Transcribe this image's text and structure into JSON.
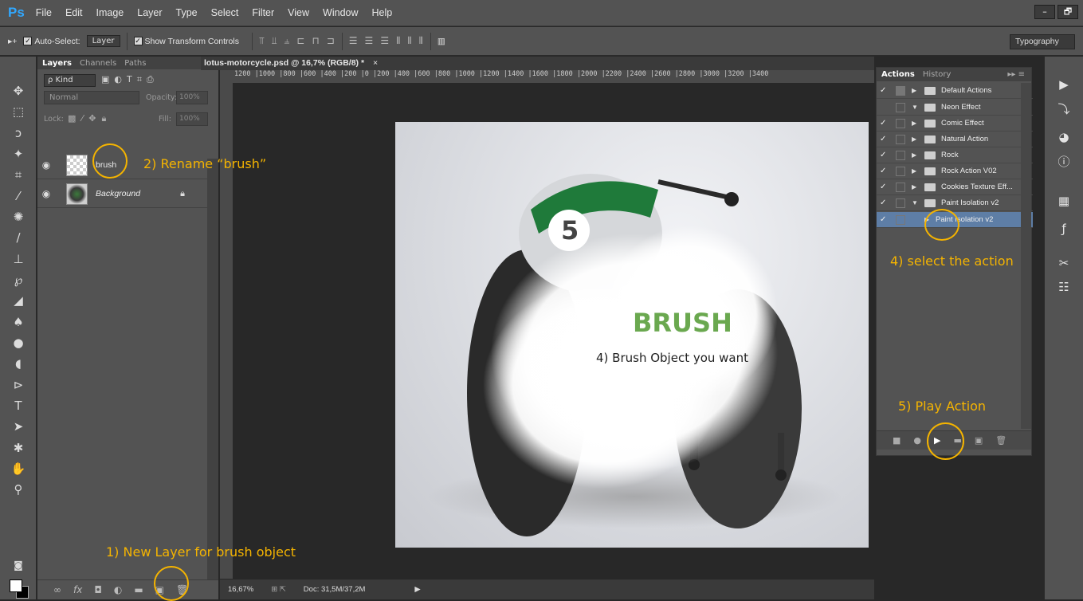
{
  "app": {
    "logo": "Ps",
    "menu": [
      "File",
      "Edit",
      "Image",
      "Layer",
      "Type",
      "Select",
      "Filter",
      "View",
      "Window",
      "Help"
    ],
    "window_controls": [
      "–",
      "🗗"
    ]
  },
  "options_bar": {
    "move_icon": "▸+",
    "auto_select_label": "Auto-Select:",
    "auto_select_value": "Layer",
    "show_transform_label": "Show Transform Controls",
    "workspace": "Typography"
  },
  "layers_panel": {
    "tabs": [
      "Layers",
      "Channels",
      "Paths"
    ],
    "filter_kind": "ρ Kind",
    "blend_mode": "Normal",
    "opacity_label": "Opacity:",
    "opacity_value": "100%",
    "lock_label": "Lock:",
    "fill_label": "Fill:",
    "fill_value": "100%",
    "layers": [
      {
        "name": "brush"
      },
      {
        "name": "Background"
      }
    ]
  },
  "document": {
    "tab_title": "lotus-motorcycle.psd @ 16,7% (RGB/8) *",
    "tab_close": "×",
    "ruler_ticks": "1200 |1000 |800  |600  |400  |200  |0    |200  |400  |600  |800  |1000 |1200 |1400 |1600 |1800 |2000 |2200 |2400 |2600 |2800 |3000 |3200 |3400",
    "zoom": "16,67%",
    "doc_size": "Doc: 31,5M/37,2M",
    "photo_number": "5"
  },
  "actions_panel": {
    "tabs": [
      "Actions",
      "History"
    ],
    "items": [
      {
        "name": "Default Actions",
        "check": "✓"
      },
      {
        "name": "Neon Effect",
        "check": ""
      },
      {
        "name": "Comic Effect",
        "check": "✓"
      },
      {
        "name": "Natural Action",
        "check": "✓"
      },
      {
        "name": "Rock",
        "check": "✓"
      },
      {
        "name": "Rock Action V02",
        "check": "✓"
      },
      {
        "name": "Cookies Texture Eff...",
        "check": "✓"
      },
      {
        "name": "Paint Isolation v2",
        "check": "✓"
      },
      {
        "name": "Paint Isolation v2",
        "check": "✓"
      }
    ]
  },
  "annotations": {
    "step1": "1) New Layer for brush object",
    "step2": "2) Rename “brush”",
    "step4a": "4) select the action",
    "step4b": "4) Brush Object you want",
    "step5": "5) Play Action",
    "brush_title": "BRUSH"
  },
  "colors": {
    "annotation": "#f5b400",
    "brush_title": "#6aa84f",
    "selection": "#5e7ea6"
  }
}
